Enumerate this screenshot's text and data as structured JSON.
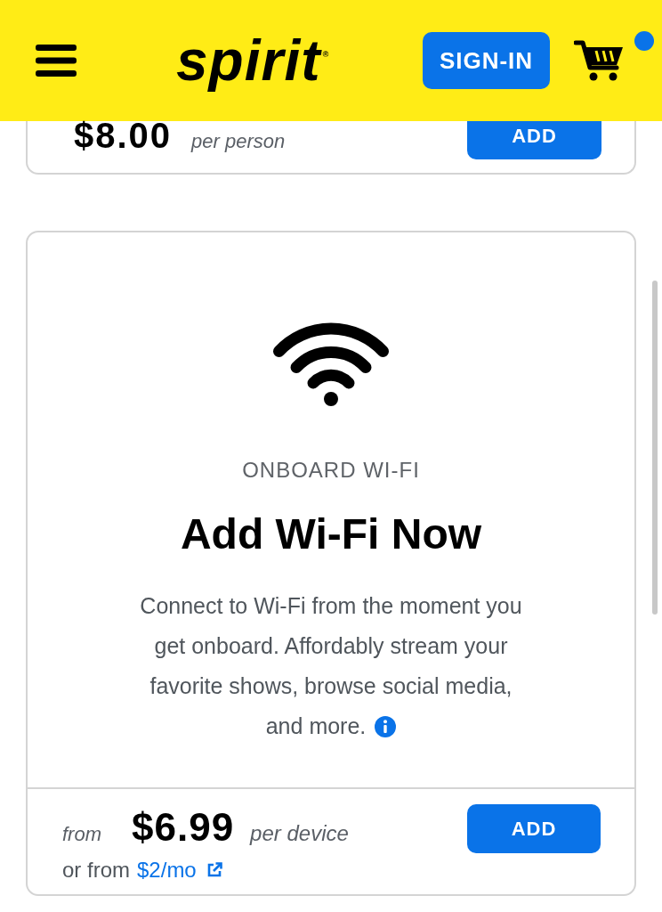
{
  "header": {
    "logo": "spirit$^{®}$",
    "sign_in_button": "SIGN-IN",
    "cart": {
      "notification": true
    }
  },
  "offers": [
    {
      "kind": "compact",
      "price": "$8.00",
      "unit": "per person",
      "button": "ADD"
    },
    {
      "kind": "full",
      "category": "ONBOARD WI-FI",
      "title": "Add Wi-Fi Now",
      "description": "Connect to Wi-Fi from the moment you get onboard. Affordably stream your favorite shows, browse social media,",
      "description_end": "and more.",
      "price_prefix": "from",
      "price": "$6.99",
      "unit": "per device",
      "alt_prefix": "or from",
      "alt_link": "$2/mo",
      "button": "ADD"
    }
  ]
}
